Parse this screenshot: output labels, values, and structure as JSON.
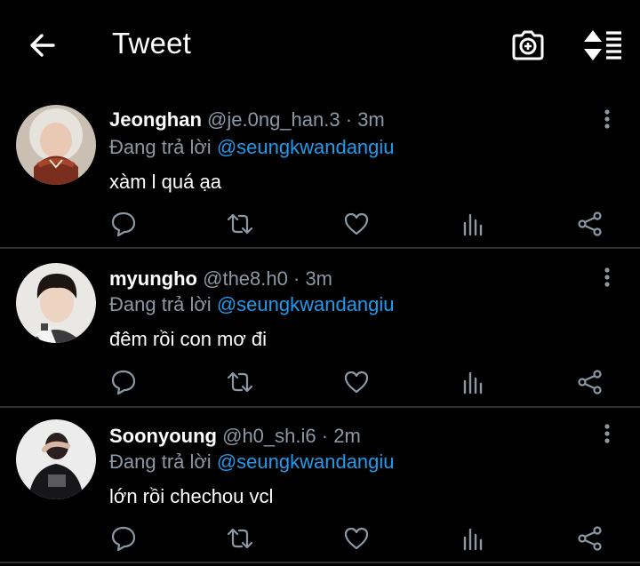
{
  "header": {
    "title": "Tweet"
  },
  "reply_prefix": "Đang trả lời",
  "tweets": [
    {
      "name": "Jeonghan",
      "handle": "@je.0ng_han.3",
      "time": "3m",
      "reply_to": "@seungkwandangiu",
      "text": "xàm l quá ạa"
    },
    {
      "name": "myungho",
      "handle": "@the8.h0",
      "time": "3m",
      "reply_to": "@seungkwandangiu",
      "text": "đêm rồi con mơ đi"
    },
    {
      "name": "Soonyoung",
      "handle": "@h0_sh.i6",
      "time": "2m",
      "reply_to": "@seungkwandangiu",
      "text": "lớn rồi chechou vcl"
    }
  ],
  "separator": "·",
  "icons": {
    "back": "arrow-left-icon",
    "camera": "camera-plus-icon",
    "sort": "sort-icon",
    "more": "more-vertical-icon",
    "reply": "reply-icon",
    "retweet": "retweet-icon",
    "like": "heart-icon",
    "stats": "analytics-icon",
    "share": "share-icon"
  },
  "colors": {
    "background": "#000000",
    "link": "#1d9bf0",
    "muted": "#8b98a5",
    "divider": "#2f3336"
  }
}
